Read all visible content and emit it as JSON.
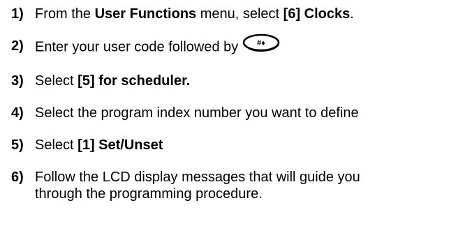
{
  "steps": [
    {
      "num": "1)",
      "pre": "From the ",
      "bold1": "User Functions",
      "mid": " menu, select ",
      "bold2": "[6] Clocks",
      "post": "."
    },
    {
      "num": "2)",
      "text": "Enter your user code followed by",
      "key_icon": "hash-key-icon",
      "key_glyph": "#♦"
    },
    {
      "num": "3)",
      "pre": "Select ",
      "bold": "[5] for scheduler."
    },
    {
      "num": "4)",
      "text": "Select the program index number you want to define"
    },
    {
      "num": "5)",
      "pre": "Select ",
      "bold": "[1] Set/Unset"
    },
    {
      "num": "6)",
      "line1": "Follow the LCD display messages that will guide you",
      "line2": "through the programming procedure."
    }
  ]
}
